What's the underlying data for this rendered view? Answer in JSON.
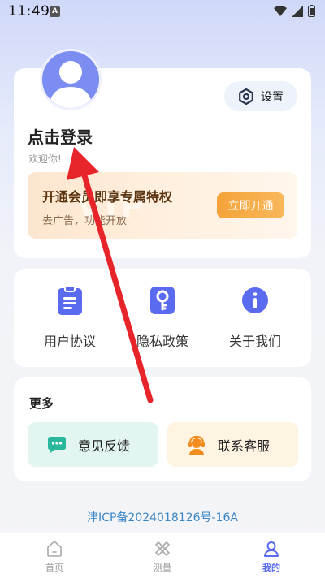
{
  "status_bar": {
    "time": "11:49",
    "notif_glyph": "A"
  },
  "profile": {
    "settings_label": "设置",
    "login_title": "点击登录",
    "welcome": "欢迎你!"
  },
  "vip": {
    "watermark": "VIP",
    "title": "开通会员即享专属特权",
    "subtitle": "去广告，功能开放",
    "button": "立即开通"
  },
  "links": [
    {
      "label": "用户协议",
      "icon": "document-icon"
    },
    {
      "label": "隐私政策",
      "icon": "key-icon"
    },
    {
      "label": "关于我们",
      "icon": "info-icon"
    }
  ],
  "more": {
    "title": "更多",
    "feedback": "意见反馈",
    "service": "联系客服"
  },
  "icp": "津ICP备2024018126号-16A",
  "nav": [
    {
      "label": "首页",
      "icon": "home-icon"
    },
    {
      "label": "测量",
      "icon": "ruler-icon"
    },
    {
      "label": "我的",
      "icon": "profile-icon",
      "active": true
    }
  ],
  "colors": {
    "accent": "#5b6bef",
    "avatar": "#7b8df0",
    "vip_button": "#f5a33a",
    "feedback_bg": "#e2f5f1",
    "service_bg": "#fff3e2",
    "icp_link": "#3b86c6",
    "annotation_arrow": "#e8242b"
  }
}
